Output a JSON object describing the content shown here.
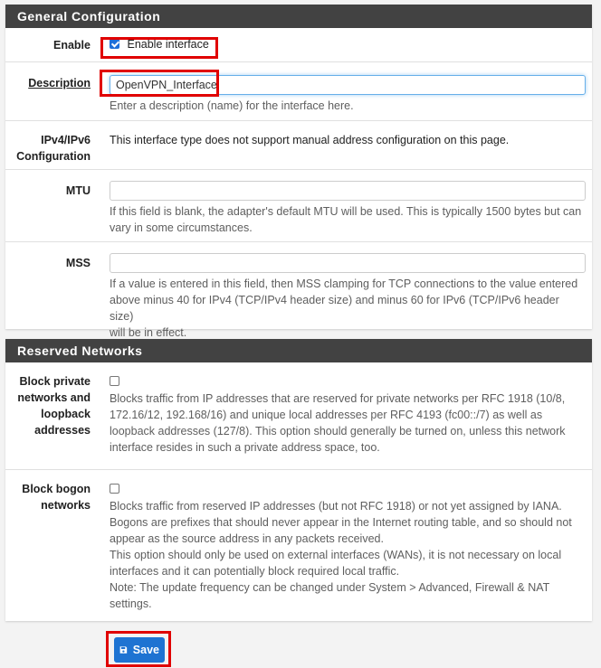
{
  "general": {
    "heading": "General Configuration",
    "enable": {
      "label": "Enable",
      "checkbox_label": "Enable interface",
      "checked": true
    },
    "description": {
      "label": "Description",
      "value": "OpenVPN_Interface",
      "help": "Enter a description (name) for the interface here."
    },
    "ip_config": {
      "label_line1": "IPv4/IPv6",
      "label_line2": "Configuration",
      "text": "This interface type does not support manual address configuration on this page."
    },
    "mtu": {
      "label": "MTU",
      "value": "",
      "help_line1": "If this field is blank, the adapter's default MTU will be used. This is typically 1500 bytes but can",
      "help_line2": "vary in some circumstances."
    },
    "mss": {
      "label": "MSS",
      "value": "",
      "help_line1": "If a value is entered in this field, then MSS clamping for TCP connections to the value entered",
      "help_line2": "above minus 40 for IPv4 (TCP/IPv4 header size) and minus 60 for IPv6 (TCP/IPv6 header size)",
      "help_line3": "will be in effect."
    }
  },
  "reserved": {
    "heading": "Reserved Networks",
    "block_private": {
      "label_lines": [
        "Block private",
        "networks and",
        "loopback",
        "addresses"
      ],
      "checked": false,
      "help_lines": [
        "Blocks traffic from IP addresses that are reserved for private networks per RFC 1918 (10/8,",
        "172.16/12, 192.168/16) and unique local addresses per RFC 4193 (fc00::/7) as well as",
        "loopback addresses (127/8). This option should generally be turned on, unless this network",
        "interface resides in such a private address space, too."
      ]
    },
    "block_bogon": {
      "label_lines": [
        "Block bogon",
        "networks"
      ],
      "checked": false,
      "help_lines": [
        "Blocks traffic from reserved IP addresses (but not RFC 1918) or not yet assigned by IANA.",
        "Bogons are prefixes that should never appear in the Internet routing table, and so should not",
        "appear as the source address in any packets received.",
        "This option should only be used on external interfaces (WANs), it is not necessary on local",
        "interfaces and it can potentially block required local traffic.",
        "Note: The update frequency can be changed under System > Advanced, Firewall & NAT",
        "settings."
      ]
    }
  },
  "actions": {
    "save_label": "Save",
    "save_icon": "floppy-disk-icon"
  },
  "colors": {
    "heading_bg": "#424242",
    "primary": "#1e73d2",
    "highlight": "#e00000"
  }
}
